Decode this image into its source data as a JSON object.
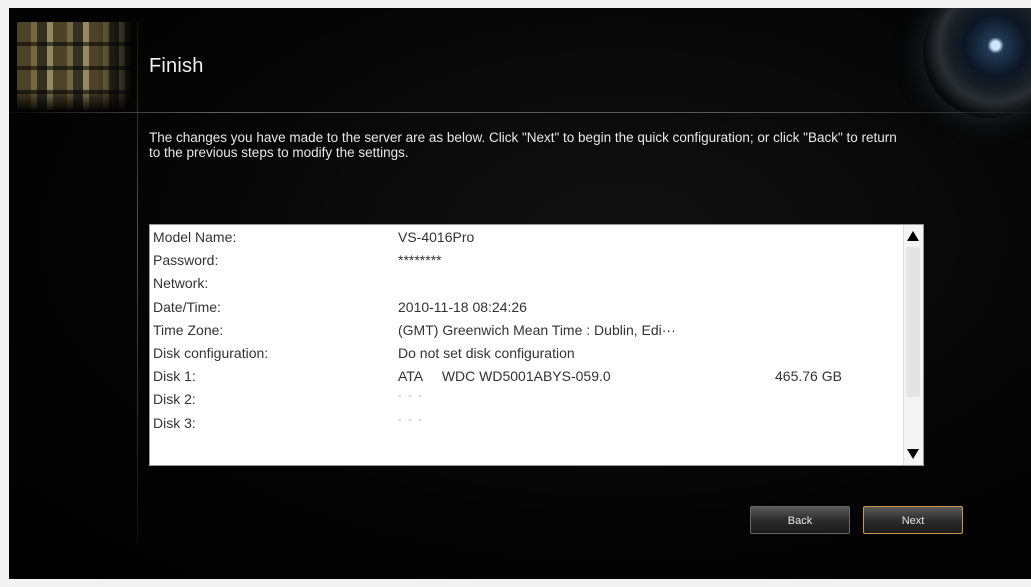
{
  "header": {
    "title": "Finish"
  },
  "instructions": "The changes you have made to the server are as below. Click \"Next\" to begin the quick configuration; or click \"Back\" to return to the previous steps to modify the settings.",
  "summary": {
    "rows": [
      {
        "label": "Model Name:",
        "value": "VS-4016Pro"
      },
      {
        "label": "Password:",
        "value": "********"
      },
      {
        "label": "Network:",
        "value": ""
      },
      {
        "label": "Date/Time:",
        "value": "2010-11-18 08:24:26"
      },
      {
        "label": "Time Zone:",
        "value": "(GMT) Greenwich Mean Time : Dublin, Edi···"
      },
      {
        "label": "Disk configuration:",
        "value": "Do not set disk configuration"
      },
      {
        "label": "Disk 1:",
        "value": "ATA     WDC WD5001ABYS-059.0",
        "size": "465.76 GB"
      },
      {
        "label": "Disk 2:",
        "value": "- - -"
      },
      {
        "label": "Disk 3:",
        "value": "- - -"
      }
    ]
  },
  "buttons": {
    "back": "Back",
    "next": "Next"
  },
  "colors": {
    "next_border": "#c79a3a",
    "background": "#000000"
  },
  "icons": {
    "scroll_up": "triangle-up-icon",
    "scroll_down": "triangle-down-icon"
  }
}
